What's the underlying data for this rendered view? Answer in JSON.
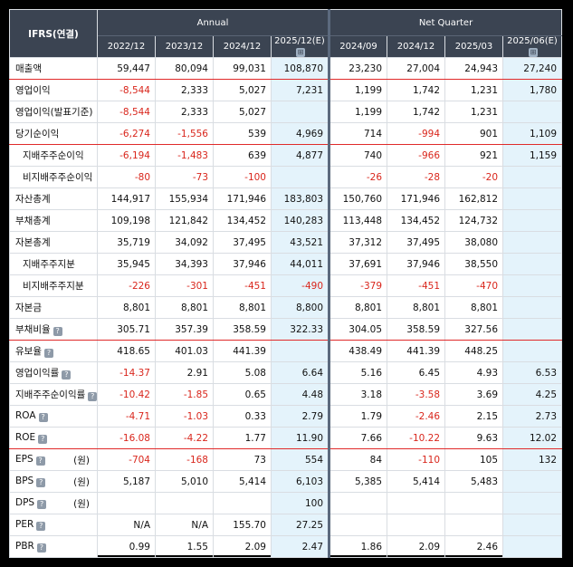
{
  "header": {
    "corner": "IFRS(연결)",
    "annual_label": "Annual",
    "quarter_label": "Net Quarter",
    "est_icon": "⊞",
    "columns": [
      "2022/12",
      "2023/12",
      "2024/12",
      "2025/12(E)",
      "2024/09",
      "2024/12",
      "2025/03",
      "2025/06(E)"
    ]
  },
  "help_icon": "?",
  "rows": [
    {
      "label": "매출액",
      "unit": "",
      "help": false,
      "indent": false,
      "redline": true,
      "values": [
        "59,447",
        "80,094",
        "99,031",
        "108,870",
        "23,230",
        "27,004",
        "24,943",
        "27,240"
      ]
    },
    {
      "label": "영업이익",
      "unit": "",
      "help": false,
      "indent": false,
      "redline": false,
      "values": [
        "-8,544",
        "2,333",
        "5,027",
        "7,231",
        "1,199",
        "1,742",
        "1,231",
        "1,780"
      ]
    },
    {
      "label": "영업이익(발표기준)",
      "unit": "",
      "help": false,
      "indent": false,
      "redline": false,
      "values": [
        "-8,544",
        "2,333",
        "5,027",
        "",
        "1,199",
        "1,742",
        "1,231",
        ""
      ]
    },
    {
      "label": "당기순이익",
      "unit": "",
      "help": false,
      "indent": false,
      "redline": true,
      "values": [
        "-6,274",
        "-1,556",
        "539",
        "4,969",
        "714",
        "-994",
        "901",
        "1,109"
      ]
    },
    {
      "label": "지배주주순이익",
      "unit": "",
      "help": false,
      "indent": true,
      "redline": false,
      "values": [
        "-6,194",
        "-1,483",
        "639",
        "4,877",
        "740",
        "-966",
        "921",
        "1,159"
      ]
    },
    {
      "label": "비지배주주순이익",
      "unit": "",
      "help": false,
      "indent": true,
      "redline": false,
      "values": [
        "-80",
        "-73",
        "-100",
        "",
        "-26",
        "-28",
        "-20",
        ""
      ]
    },
    {
      "label": "자산총계",
      "unit": "",
      "help": false,
      "indent": false,
      "redline": false,
      "values": [
        "144,917",
        "155,934",
        "171,946",
        "183,803",
        "150,760",
        "171,946",
        "162,812",
        ""
      ]
    },
    {
      "label": "부채총계",
      "unit": "",
      "help": false,
      "indent": false,
      "redline": false,
      "values": [
        "109,198",
        "121,842",
        "134,452",
        "140,283",
        "113,448",
        "134,452",
        "124,732",
        ""
      ]
    },
    {
      "label": "자본총계",
      "unit": "",
      "help": false,
      "indent": false,
      "redline": false,
      "values": [
        "35,719",
        "34,092",
        "37,495",
        "43,521",
        "37,312",
        "37,495",
        "38,080",
        ""
      ]
    },
    {
      "label": "지배주주지분",
      "unit": "",
      "help": false,
      "indent": true,
      "redline": false,
      "values": [
        "35,945",
        "34,393",
        "37,946",
        "44,011",
        "37,691",
        "37,946",
        "38,550",
        ""
      ]
    },
    {
      "label": "비지배주주지분",
      "unit": "",
      "help": false,
      "indent": true,
      "redline": false,
      "values": [
        "-226",
        "-301",
        "-451",
        "-490",
        "-379",
        "-451",
        "-470",
        ""
      ]
    },
    {
      "label": "자본금",
      "unit": "",
      "help": false,
      "indent": false,
      "redline": false,
      "values": [
        "8,801",
        "8,801",
        "8,801",
        "8,800",
        "8,801",
        "8,801",
        "8,801",
        ""
      ]
    },
    {
      "label": "부채비율",
      "unit": "",
      "help": true,
      "indent": false,
      "redline": true,
      "values": [
        "305.71",
        "357.39",
        "358.59",
        "322.33",
        "304.05",
        "358.59",
        "327.56",
        ""
      ]
    },
    {
      "label": "유보율",
      "unit": "",
      "help": true,
      "indent": false,
      "redline": false,
      "values": [
        "418.65",
        "401.03",
        "441.39",
        "",
        "438.49",
        "441.39",
        "448.25",
        ""
      ]
    },
    {
      "label": "영업이익률",
      "unit": "",
      "help": true,
      "indent": false,
      "redline": false,
      "values": [
        "-14.37",
        "2.91",
        "5.08",
        "6.64",
        "5.16",
        "6.45",
        "4.93",
        "6.53"
      ]
    },
    {
      "label": "지배주주순이익률",
      "unit": "",
      "help": true,
      "indent": false,
      "redline": false,
      "values": [
        "-10.42",
        "-1.85",
        "0.65",
        "4.48",
        "3.18",
        "-3.58",
        "3.69",
        "4.25"
      ]
    },
    {
      "label": "ROA",
      "unit": "",
      "help": true,
      "indent": false,
      "redline": false,
      "values": [
        "-4.71",
        "-1.03",
        "0.33",
        "2.79",
        "1.79",
        "-2.46",
        "2.15",
        "2.73"
      ]
    },
    {
      "label": "ROE",
      "unit": "",
      "help": true,
      "indent": false,
      "redline": true,
      "values": [
        "-16.08",
        "-4.22",
        "1.77",
        "11.90",
        "7.66",
        "-10.22",
        "9.63",
        "12.02"
      ]
    },
    {
      "label": "EPS",
      "unit": "(원)",
      "help": true,
      "indent": false,
      "redline": false,
      "values": [
        "-704",
        "-168",
        "73",
        "554",
        "84",
        "-110",
        "105",
        "132"
      ]
    },
    {
      "label": "BPS",
      "unit": "(원)",
      "help": true,
      "indent": false,
      "redline": false,
      "values": [
        "5,187",
        "5,010",
        "5,414",
        "6,103",
        "5,385",
        "5,414",
        "5,483",
        ""
      ]
    },
    {
      "label": "DPS",
      "unit": "(원)",
      "help": true,
      "indent": false,
      "redline": false,
      "values": [
        "",
        "",
        "",
        "100",
        "",
        "",
        "",
        ""
      ]
    },
    {
      "label": "PER",
      "unit": "",
      "help": true,
      "indent": false,
      "redline": false,
      "values": [
        "N/A",
        "N/A",
        "155.70",
        "27.25",
        "",
        "",
        "",
        ""
      ]
    },
    {
      "label": "PBR",
      "unit": "",
      "help": true,
      "indent": false,
      "redline": false,
      "values": [
        "0.99",
        "1.55",
        "2.09",
        "2.47",
        "1.86",
        "2.09",
        "2.46",
        ""
      ]
    }
  ]
}
